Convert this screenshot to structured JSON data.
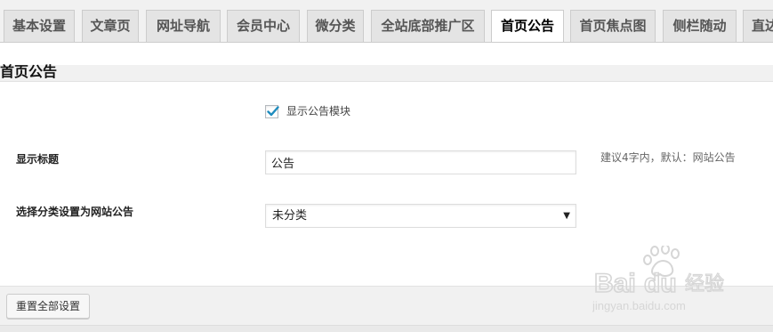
{
  "tabs": [
    {
      "label": "基本设置",
      "active": false
    },
    {
      "label": "文章页",
      "active": false
    },
    {
      "label": "网址导航",
      "active": false
    },
    {
      "label": "会员中心",
      "active": false
    },
    {
      "label": "微分类",
      "active": false
    },
    {
      "label": "全站底部推广区",
      "active": false
    },
    {
      "label": "首页公告",
      "active": true
    },
    {
      "label": "首页焦点图",
      "active": false
    },
    {
      "label": "侧栏随动",
      "active": false
    },
    {
      "label": "直达",
      "active": false
    }
  ],
  "section": {
    "title": "首页公告"
  },
  "form": {
    "show_module": {
      "label": "显示公告模块",
      "checked": true
    },
    "title_field": {
      "label": "显示标题",
      "value": "公告",
      "hint": "建议4字内，默认：网站公告"
    },
    "category_field": {
      "label": "选择分类设置为网站公告",
      "selected": "未分类"
    }
  },
  "footer": {
    "reset_label": "重置全部设置"
  },
  "watermark": {
    "text": "jingyan.baidu.com"
  },
  "colors": {
    "checkbox_check": "#1e8cbe",
    "watermark": "#d9d9d9"
  }
}
